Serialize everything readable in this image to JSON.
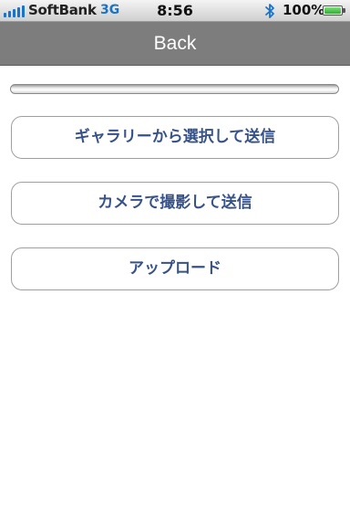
{
  "status_bar": {
    "carrier": "SoftBank",
    "network": "3G",
    "time": "8:56",
    "battery_text": "100%",
    "battery_level": 1.0,
    "signal_icon": "signal-bars-icon",
    "bluetooth_icon": "bluetooth-icon",
    "battery_icon": "battery-icon"
  },
  "nav": {
    "back_label": "Back"
  },
  "upload_progress": {
    "value": 0
  },
  "actions": {
    "gallery_label": "ギャラリーから選択して送信",
    "camera_label": "カメラで撮影して送信",
    "upload_label": "アップロード"
  },
  "colors": {
    "nav_background": "#7d7d7d",
    "button_text": "#375289",
    "status_accent": "#1a73c9"
  }
}
